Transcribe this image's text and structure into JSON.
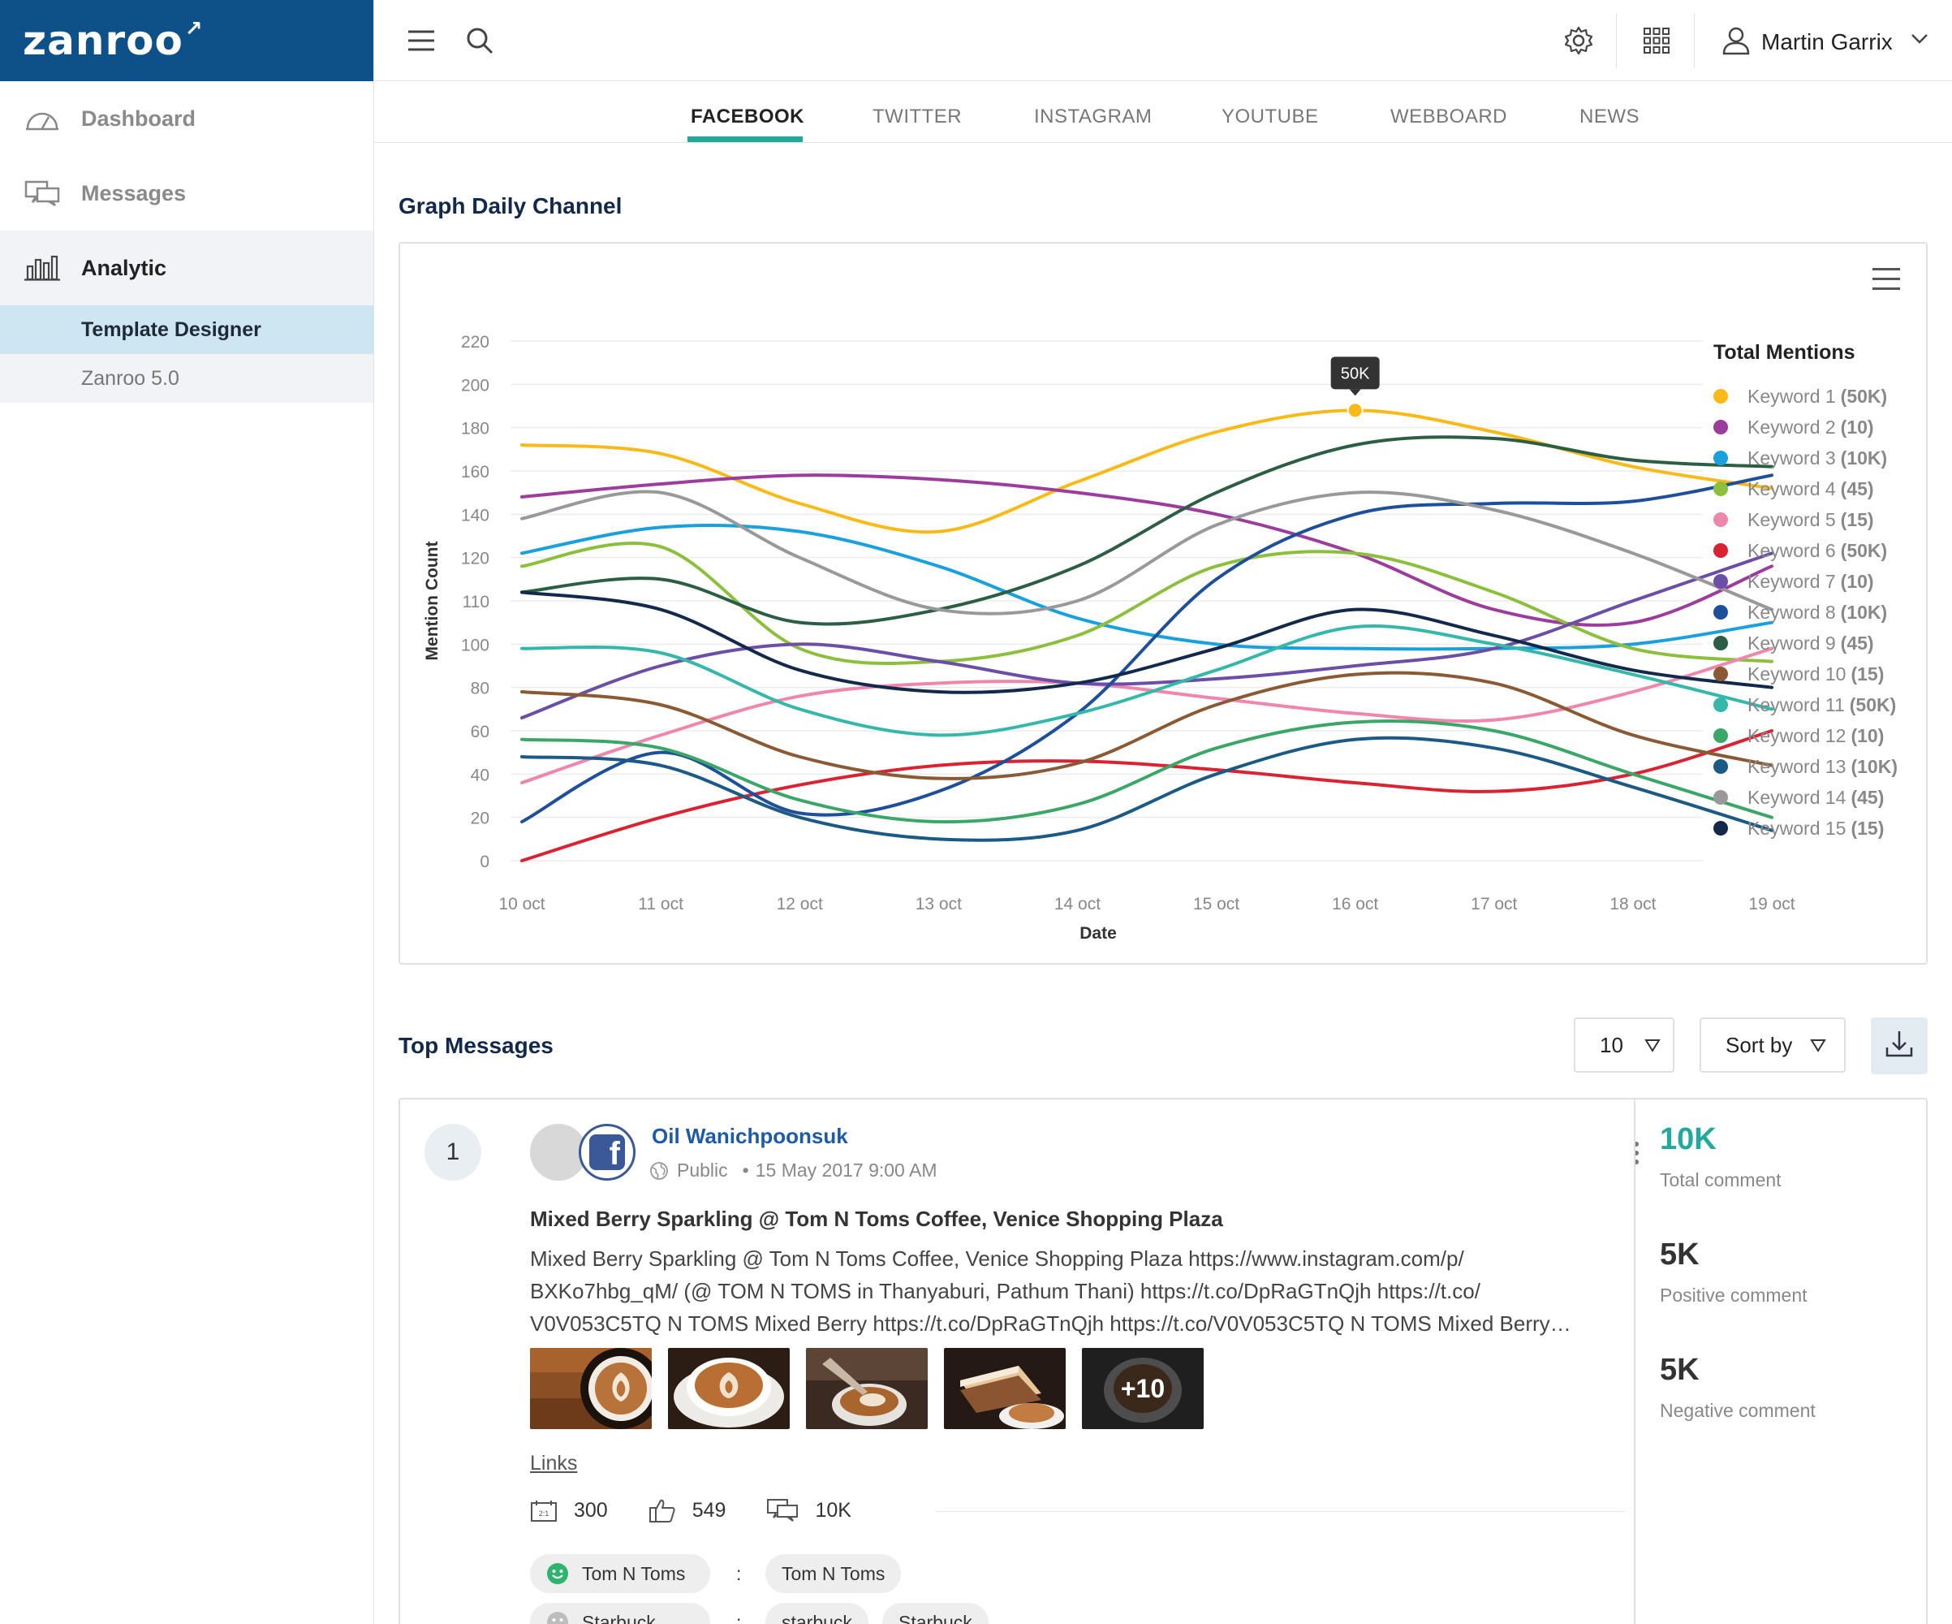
{
  "brand": {
    "logo": "zanroo"
  },
  "sidebar": {
    "items": [
      {
        "label": "Dashboard",
        "icon": "speedometer-icon"
      },
      {
        "label": "Messages",
        "icon": "chat-icon"
      },
      {
        "label": "Analytic",
        "icon": "bar-chart-icon"
      }
    ],
    "sub_items": [
      {
        "label": "Template Designer"
      },
      {
        "label": "Zanroo 5.0"
      }
    ]
  },
  "topbar": {
    "user_name": "Martin Garrix"
  },
  "tabs": [
    "FACEBOOK",
    "TWITTER",
    "INSTAGRAM",
    "YOUTUBE",
    "WEBBOARD",
    "NEWS"
  ],
  "accent_color": "#23a99b",
  "graph_section": {
    "title": "Graph Daily Channel"
  },
  "chart_data": {
    "type": "line",
    "xlabel": "Date",
    "ylabel": "Mention Count",
    "x": [
      "10 oct",
      "11 oct",
      "12 oct",
      "13 oct",
      "14 oct",
      "15 oct",
      "16 oct",
      "17 oct",
      "18 oct",
      "19 oct"
    ],
    "y_ticks": [
      "220",
      "200",
      "180",
      "160",
      "140",
      "120",
      "110",
      "100",
      "80",
      "60",
      "40",
      "20",
      "0"
    ],
    "grid": true,
    "legend_title": "Total Mentions",
    "legend_position": "right",
    "tooltip": {
      "series": "Keyword 1",
      "x": "16 oct",
      "value": 188,
      "label": "50K"
    },
    "series": [
      {
        "name": "Keyword 1",
        "total": "(50K)",
        "color": "#f9b917",
        "values": [
          172,
          168,
          145,
          132,
          155,
          178,
          188,
          178,
          162,
          152
        ]
      },
      {
        "name": "Keyword 2",
        "total": "(10)",
        "color": "#9c3c9c",
        "values": [
          148,
          154,
          158,
          156,
          150,
          140,
          122,
          108,
          105,
          118
        ]
      },
      {
        "name": "Keyword 3",
        "total": "(10K)",
        "color": "#1aa0dc",
        "values": [
          122,
          134,
          132,
          118,
          106,
          100,
          98,
          98,
          100,
          105
        ]
      },
      {
        "name": "Keyword 4",
        "total": "(45)",
        "color": "#8dbf3f",
        "values": [
          118,
          125,
          98,
          92,
          102,
          118,
          122,
          112,
          98,
          92
        ]
      },
      {
        "name": "Keyword 5",
        "total": "(15)",
        "color": "#ef86ab",
        "values": [
          36,
          58,
          76,
          82,
          82,
          75,
          68,
          65,
          78,
          98
        ]
      },
      {
        "name": "Keyword 6",
        "total": "(50K)",
        "color": "#d92332",
        "values": [
          0,
          20,
          35,
          44,
          46,
          42,
          36,
          32,
          40,
          60
        ]
      },
      {
        "name": "Keyword 7",
        "total": "(10)",
        "color": "#6b4ea6",
        "values": [
          66,
          90,
          100,
          92,
          82,
          84,
          90,
          98,
          110,
          122
        ]
      },
      {
        "name": "Keyword 8",
        "total": "(10K)",
        "color": "#1e4f9a",
        "values": [
          18,
          50,
          22,
          32,
          68,
          115,
          140,
          145,
          146,
          158
        ]
      },
      {
        "name": "Keyword 9",
        "total": "(45)",
        "color": "#2b5e45",
        "values": [
          112,
          115,
          105,
          108,
          118,
          150,
          172,
          175,
          165,
          162
        ]
      },
      {
        "name": "Keyword 10",
        "total": "(15)",
        "color": "#8a5a34",
        "values": [
          78,
          72,
          48,
          38,
          45,
          72,
          86,
          82,
          58,
          44
        ]
      },
      {
        "name": "Keyword 11",
        "total": "(50K)",
        "color": "#35b7aa",
        "values": [
          98,
          96,
          70,
          58,
          68,
          88,
          104,
          100,
          86,
          70
        ]
      },
      {
        "name": "Keyword 12",
        "total": "(10)",
        "color": "#3aa667",
        "values": [
          56,
          52,
          28,
          18,
          26,
          52,
          64,
          60,
          40,
          20
        ]
      },
      {
        "name": "Keyword 13",
        "total": "(10K)",
        "color": "#1b5a85",
        "values": [
          48,
          44,
          20,
          10,
          14,
          40,
          56,
          52,
          34,
          14
        ]
      },
      {
        "name": "Keyword 14",
        "total": "(45)",
        "color": "#999999",
        "values": [
          138,
          150,
          120,
          108,
          110,
          135,
          150,
          142,
          122,
          108
        ]
      },
      {
        "name": "Keyword 15",
        "total": "(15)",
        "color": "#13294b",
        "values": [
          112,
          108,
          88,
          78,
          82,
          98,
          108,
          102,
          88,
          80
        ]
      }
    ]
  },
  "top_messages": {
    "title": "Top Messages",
    "count_select": "10",
    "sort_label": "Sort by",
    "messages": [
      {
        "rank": "1",
        "author": "Oil Wanichpoonsuk",
        "visibility": "Public",
        "timestamp": "15 May 2017 9:00 AM",
        "title": "Mixed Berry Sparkling @ Tom N Toms Coffee, Venice Shopping Plaza",
        "body_lines": [
          "Mixed Berry Sparkling @ Tom N Toms Coffee, Venice Shopping Plaza https://www.instagram.com/p/",
          "BXKo7hbg_qM/ (@ TOM  N TOMS in Thanyaburi, Pathum Thani)  https://t.co/DpRaGTnQjh https://t.co/",
          "V0V053C5TQ N TOMS Mixed Berry  https://t.co/DpRaGTnQjh https://t.co/V0V053C5TQ N TOMS Mixed Berry…"
        ],
        "more_images": "+10",
        "links_label": "Links",
        "shares": "300",
        "likes": "549",
        "comments": "10K",
        "tags": [
          {
            "entity": "Tom N Toms",
            "sentiment": "positive",
            "values": [
              "Tom N Toms"
            ]
          },
          {
            "entity": "Starbuck",
            "sentiment": "neutral",
            "values": [
              "starbuck",
              "Starbuck"
            ]
          }
        ],
        "side": {
          "total_value": "10K",
          "total_label": "Total comment",
          "positive_value": "5K",
          "positive_label": "Positive comment",
          "negative_value": "5K",
          "negative_label": "Negative comment"
        }
      }
    ]
  }
}
